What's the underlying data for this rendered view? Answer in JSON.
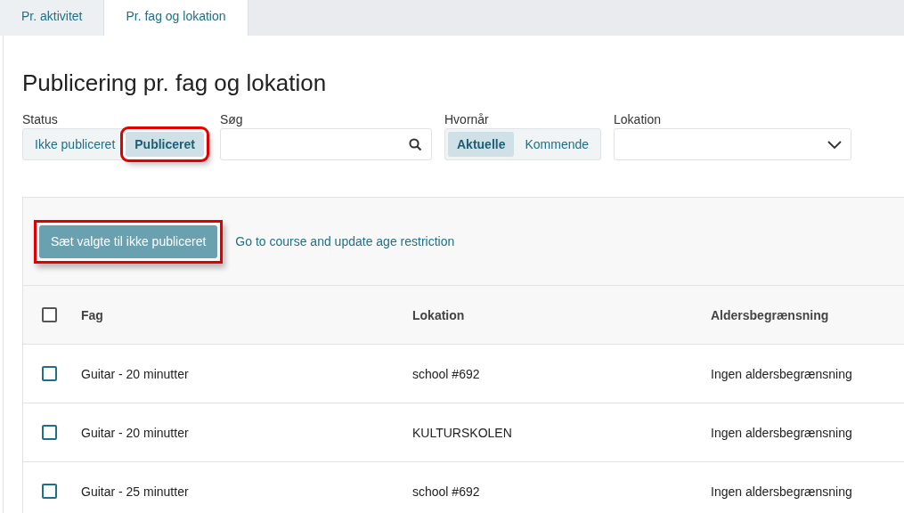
{
  "tabs": [
    {
      "label": "Pr. aktivitet",
      "selected": false
    },
    {
      "label": "Pr. fag og lokation",
      "selected": true
    }
  ],
  "title": "Publicering pr. fag og lokation",
  "filters": {
    "status": {
      "label": "Status",
      "options": [
        {
          "label": "Ikke publiceret",
          "selected": false,
          "highlighted": false
        },
        {
          "label": "Publiceret",
          "selected": true,
          "highlighted": true
        }
      ]
    },
    "search": {
      "label": "Søg"
    },
    "when": {
      "label": "Hvornår",
      "options": [
        {
          "label": "Aktuelle",
          "selected": true,
          "highlighted": false
        },
        {
          "label": "Kommende",
          "selected": false,
          "highlighted": false
        }
      ]
    },
    "location": {
      "label": "Lokation"
    }
  },
  "actions": {
    "button": {
      "label": "Sæt valgte til ikke publiceret",
      "highlighted": true
    },
    "link": "Go to course and update age restriction"
  },
  "table": {
    "select_all": {
      "checked": false
    },
    "columns": [
      "Fag",
      "Lokation",
      "Aldersbegrænsning"
    ],
    "rows": [
      {
        "checked": false,
        "cells": [
          "Guitar - 20 minutter",
          "school #692",
          "Ingen aldersbegrænsning"
        ]
      },
      {
        "checked": false,
        "cells": [
          "Guitar - 20 minutter",
          "KULTURSKOLEN",
          "Ingen aldersbegrænsning"
        ]
      },
      {
        "checked": false,
        "cells": [
          "Guitar - 25 minutter",
          "school #692",
          "Ingen aldersbegrænsning"
        ]
      }
    ]
  }
}
